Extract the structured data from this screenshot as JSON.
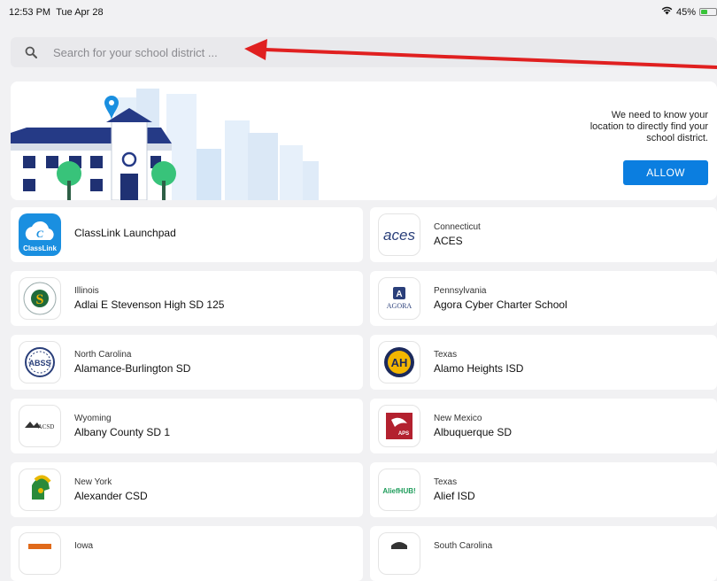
{
  "status": {
    "time": "12:53 PM",
    "date": "Tue Apr 28",
    "battery": "45%",
    "battery_level": 0.45
  },
  "search": {
    "placeholder": "Search for your school district ..."
  },
  "location": {
    "message": "We need to know your location to directly find your school district.",
    "allow_label": "ALLOW"
  },
  "districts": [
    {
      "name": "ClassLink Launchpad",
      "logo": "classlink-logo",
      "logo_text": "ClassLink"
    },
    {
      "state": "Connecticut",
      "name": "ACES",
      "logo": "aces-logo",
      "logo_text": "aces"
    },
    {
      "state": "Illinois",
      "name": "Adlai E Stevenson High SD 125",
      "logo": "stevenson-logo",
      "logo_text": "S"
    },
    {
      "state": "Pennsylvania",
      "name": "Agora Cyber Charter School",
      "logo": "agora-logo",
      "logo_text": "AGORA"
    },
    {
      "state": "North Carolina",
      "name": "Alamance-Burlington SD",
      "logo": "abss-logo",
      "logo_text": "ABSS"
    },
    {
      "state": "Texas",
      "name": "Alamo Heights ISD",
      "logo": "alamo-heights-logo",
      "logo_text": "AH"
    },
    {
      "state": "Wyoming",
      "name": "Albany County SD 1",
      "logo": "acsd-logo",
      "logo_text": "ACSD"
    },
    {
      "state": "New Mexico",
      "name": "Albuquerque SD",
      "logo": "aps-logo",
      "logo_text": "APS"
    },
    {
      "state": "New York",
      "name": "Alexander CSD",
      "logo": "trojan-logo",
      "logo_text": ""
    },
    {
      "state": "Texas",
      "name": "Alief ISD",
      "logo": "aliefhub-logo",
      "logo_text": "AliefHUB!"
    },
    {
      "state": "Iowa",
      "name": "",
      "logo": "iowa-district-logo",
      "logo_text": ""
    },
    {
      "state": "South Carolina",
      "name": "",
      "logo": "sc-district-logo",
      "logo_text": ""
    }
  ],
  "colors": {
    "accent": "#0b7ee0",
    "pin": "#1a8fe0",
    "annotation_arrow": "#e02020"
  }
}
